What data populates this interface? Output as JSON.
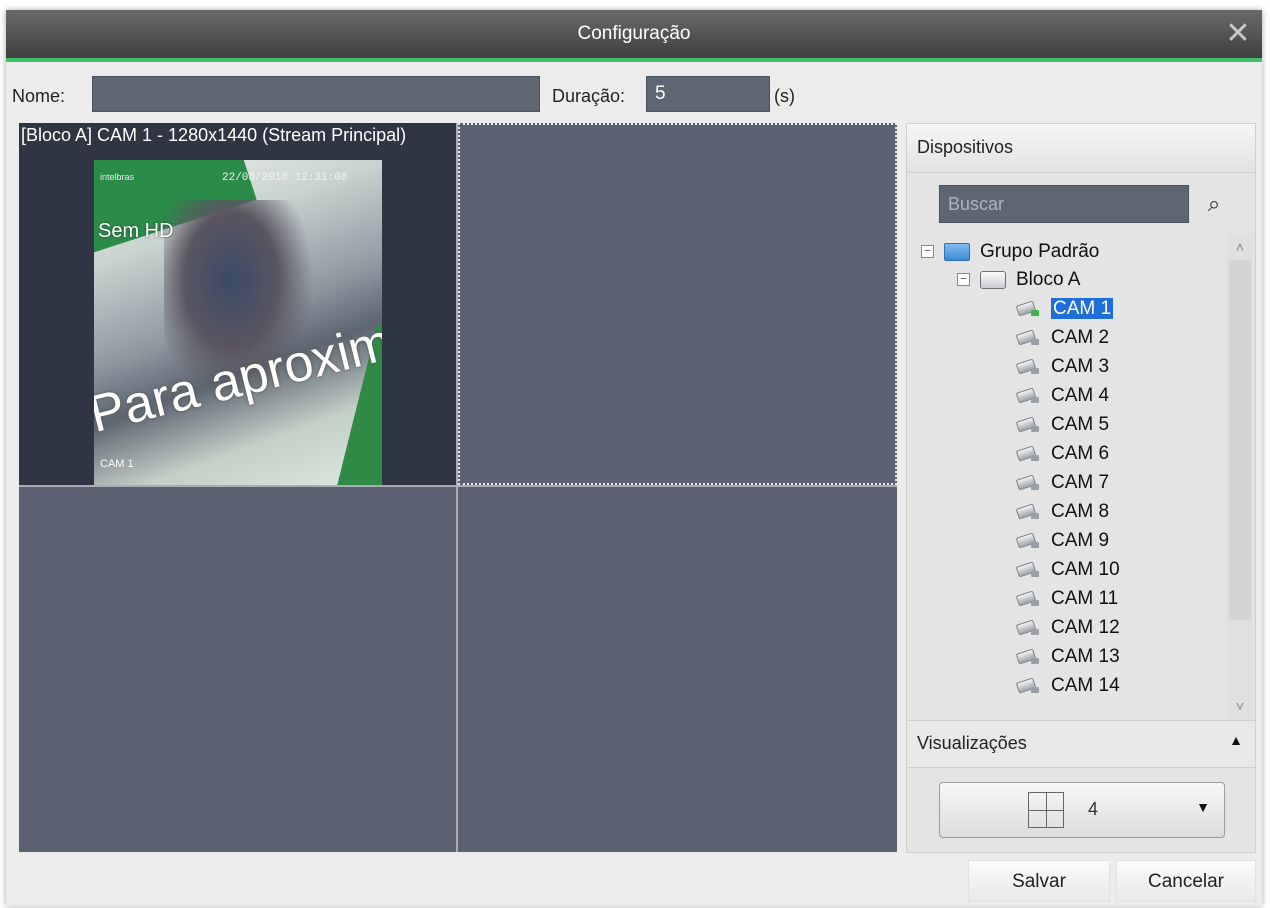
{
  "window": {
    "title": "Configuração"
  },
  "form": {
    "name_label": "Nome:",
    "name_value": "",
    "duration_label": "Duração:",
    "duration_value": "5",
    "duration_unit": "(s)"
  },
  "grid": {
    "cells": [
      {
        "label": "[Bloco A] CAM 1 - 1280x1440 (Stream Principal)",
        "overlay_timestamp": "22/08/2018 12:31:08",
        "overlay_brand": "intelbras",
        "overlay_mode": "Sem HD",
        "overlay_text": "Para aproximar",
        "overlay_cam": "CAM 1"
      },
      {
        "label": ""
      },
      {
        "label": ""
      },
      {
        "label": ""
      }
    ]
  },
  "devices": {
    "title": "Dispositivos",
    "search_placeholder": "Buscar",
    "group": "Grupo Padrão",
    "block": "Bloco A",
    "cameras": [
      "CAM 1",
      "CAM 2",
      "CAM 3",
      "CAM 4",
      "CAM 5",
      "CAM 6",
      "CAM 7",
      "CAM 8",
      "CAM 9",
      "CAM 10",
      "CAM 11",
      "CAM 12",
      "CAM 13",
      "CAM 14"
    ],
    "selected": "CAM 1"
  },
  "views": {
    "title": "Visualizações",
    "layout_value": "4"
  },
  "buttons": {
    "save": "Salvar",
    "cancel": "Cancelar"
  },
  "icons": {
    "close": "close-icon",
    "search": "search-icon",
    "group": "folder-icon",
    "block": "drive-icon",
    "camera": "camera-icon",
    "layout": "grid-2x2-icon"
  },
  "colors": {
    "accent": "#3fbf6a",
    "selection": "#1e6fd9",
    "field_bg": "#5e6673"
  }
}
